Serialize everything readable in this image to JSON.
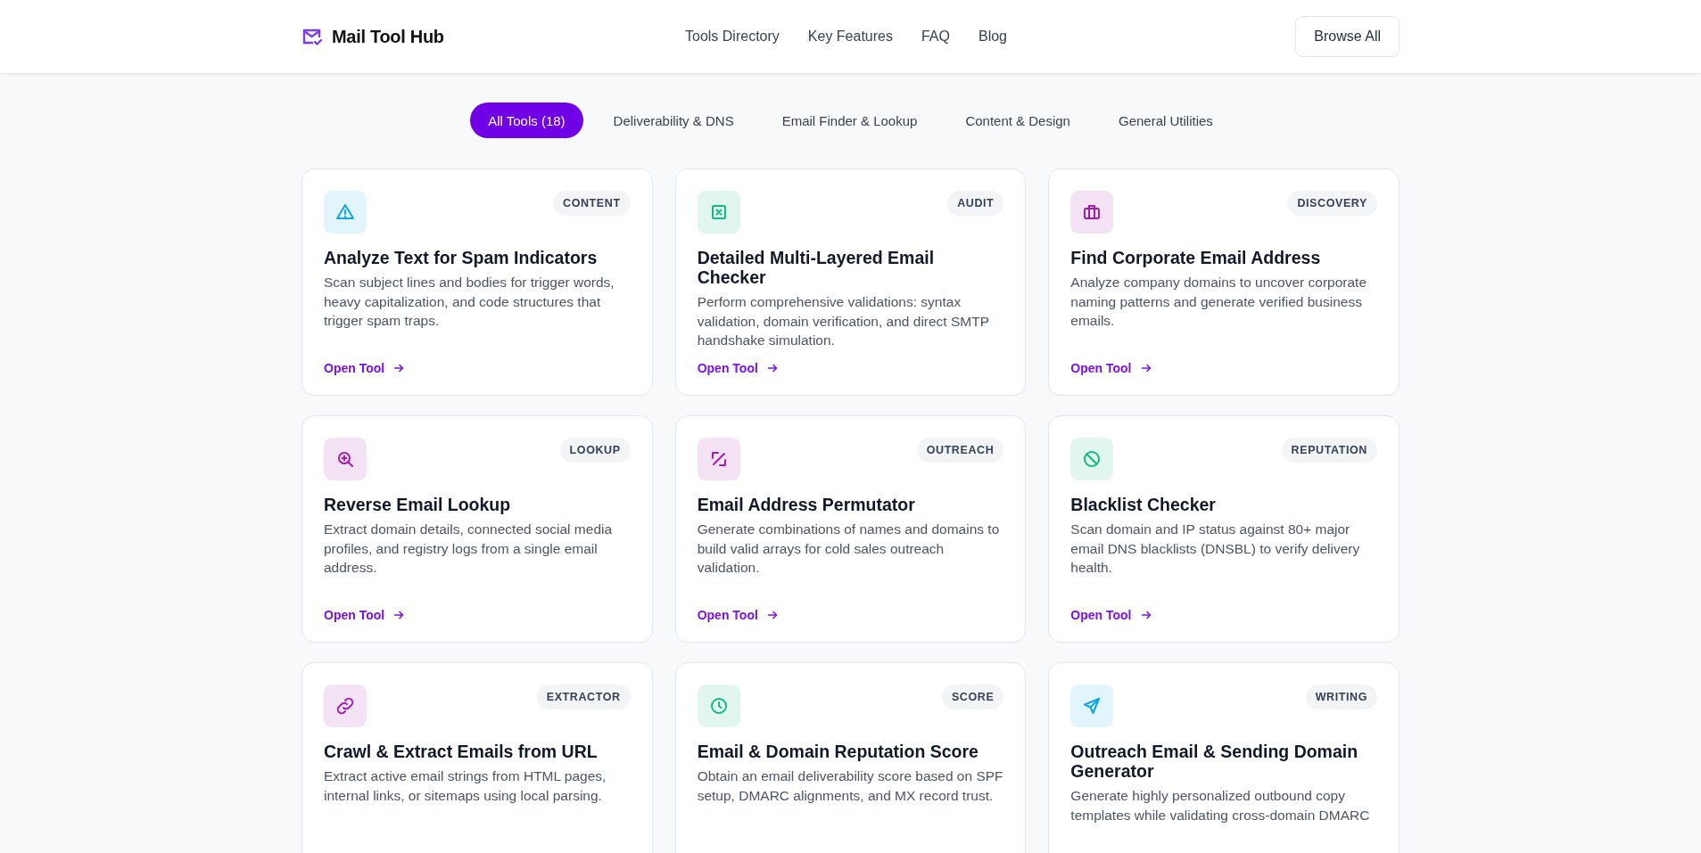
{
  "header": {
    "logo": "Mail Tool Hub",
    "nav": [
      "Tools Directory",
      "Key Features",
      "FAQ",
      "Blog"
    ],
    "button": "Browse All"
  },
  "filters": [
    {
      "label": "All Tools (18)",
      "selected": true
    },
    {
      "label": "Deliverability & DNS",
      "selected": false
    },
    {
      "label": "Email Finder & Lookup",
      "selected": false
    },
    {
      "label": "Content & Design",
      "selected": false
    },
    {
      "label": "General Utilities",
      "selected": false
    }
  ],
  "cards": [
    {
      "tag": "CONTENT",
      "color": "#0ea5e9",
      "title": "Analyze Text for Spam Indicators",
      "description": "Scan subject lines and bodies for trigger words, heavy capitalization, and code structures that trigger spam traps.",
      "link": "Open Tool"
    },
    {
      "tag": "AUDIT",
      "color": "#10b981",
      "title": "Detailed Multi-Layered Email Checker",
      "description": "Perform comprehensive validations: syntax validation, domain verification, and direct SMTP handshake simulation.",
      "link": "Open Tool"
    },
    {
      "tag": "DISCOVERY",
      "color": "#a21caf",
      "title": "Find Corporate Email Address",
      "description": "Analyze company domains to uncover corporate naming patterns and generate verified business emails.",
      "link": "Open Tool"
    },
    {
      "tag": "LOOKUP",
      "color": "#a21caf",
      "title": "Reverse Email Lookup",
      "description": "Extract domain details, connected social media profiles, and registry logs from a single email address.",
      "link": "Open Tool"
    },
    {
      "tag": "OUTREACH",
      "color": "#a21caf",
      "title": "Email Address Permutator",
      "description": "Generate combinations of names and domains to build valid arrays for cold sales outreach validation.",
      "link": "Open Tool"
    },
    {
      "tag": "REPUTATION",
      "color": "#10b981",
      "title": "Blacklist Checker",
      "description": "Scan domain and IP status against 80+ major email DNS blacklists (DNSBL) to verify delivery health.",
      "link": "Open Tool"
    },
    {
      "tag": "EXTRACTOR",
      "color": "#a21caf",
      "title": "Crawl & Extract Emails from URL",
      "description": "Extract active email strings from HTML pages, internal links, or sitemaps using local parsing."
    },
    {
      "tag": "SCORE",
      "color": "#10b981",
      "title": "Email & Domain Reputation Score",
      "description": "Obtain an email deliverability score based on SPF setup, DMARC alignments, and MX record trust."
    },
    {
      "tag": "WRITING",
      "color": "#0ea5e9",
      "title": "Outreach Email & Sending Domain Generator",
      "description": "Generate highly personalized outbound copy templates while validating cross-domain DMARC"
    }
  ]
}
